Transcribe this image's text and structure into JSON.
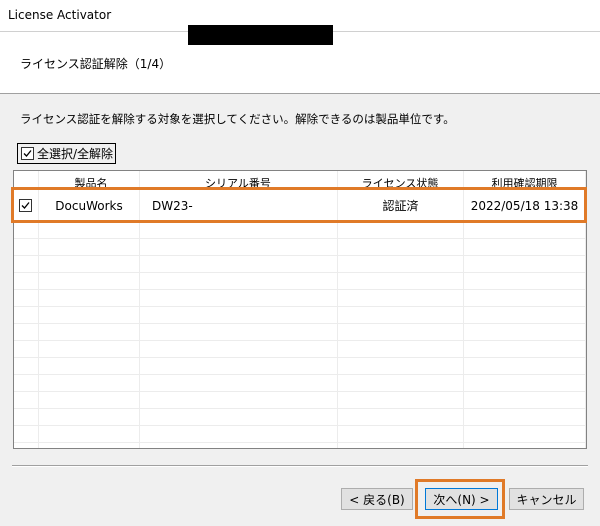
{
  "window": {
    "title": "License Activator"
  },
  "header": {
    "step_title": "ライセンス認証解除（1/4）"
  },
  "instruction": "ライセンス認証を解除する対象を選択してください。解除できるのは製品単位です。",
  "select_all": {
    "label": "全選択/全解除",
    "checked": true
  },
  "table": {
    "columns": [
      "製品名",
      "シリアル番号",
      "ライセンス状態",
      "利用確認期限"
    ],
    "rows": [
      {
        "checked": true,
        "product": "DocuWorks",
        "serial": "DW23-",
        "status": "認証済",
        "expiry": "2022/05/18 13:38"
      }
    ]
  },
  "buttons": {
    "back": "< 戻る(B)",
    "next": "次へ(N) >",
    "cancel": "キャンセル"
  },
  "colors": {
    "highlight": "#e07a28",
    "focus_border": "#0078d7"
  }
}
